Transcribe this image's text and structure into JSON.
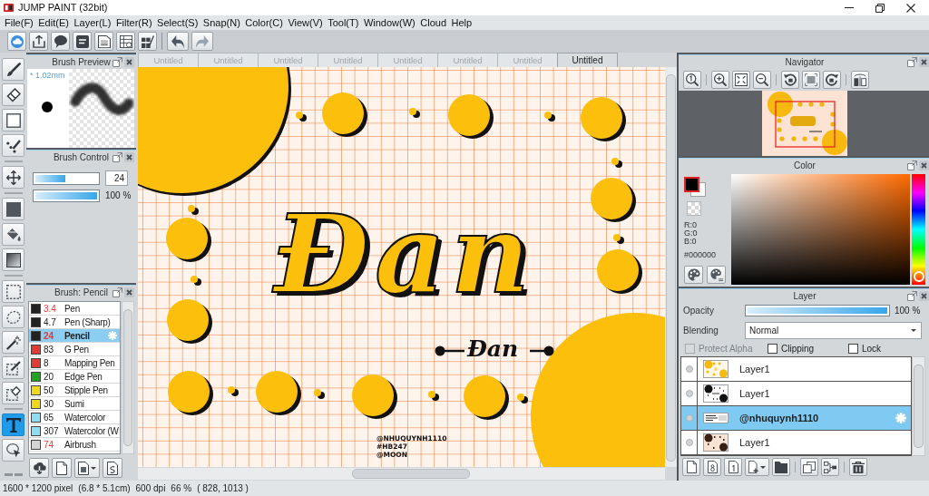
{
  "window": {
    "title": "JUMP PAINT (32bit)"
  },
  "menu": [
    "File(F)",
    "Edit(E)",
    "Layer(L)",
    "Filter(R)",
    "Select(S)",
    "Snap(N)",
    "Color(C)",
    "View(V)",
    "Tool(T)",
    "Window(W)",
    "Cloud",
    "Help"
  ],
  "tool_groups": [
    [
      {
        "kind": "brush",
        "selected": false
      },
      {
        "kind": "eraser",
        "selected": false
      },
      {
        "kind": "shape",
        "selected": false
      },
      {
        "kind": "dot",
        "selected": false
      }
    ],
    [
      {
        "kind": "move",
        "selected": false
      }
    ],
    [
      {
        "kind": "fill",
        "selected": false
      },
      {
        "kind": "bucket",
        "selected": false
      },
      {
        "kind": "gradient",
        "selected": false
      }
    ],
    [
      {
        "kind": "select",
        "selected": false
      },
      {
        "kind": "lasso",
        "selected": false
      },
      {
        "kind": "wand",
        "selected": false
      },
      {
        "kind": "select-pen",
        "selected": false
      },
      {
        "kind": "select-eraser",
        "selected": false
      }
    ],
    [
      {
        "kind": "text",
        "selected": true
      },
      {
        "kind": "object",
        "selected": false
      }
    ]
  ],
  "brush_preview": {
    "title": "Brush Preview",
    "size": "* 1.02mm"
  },
  "brush_control": {
    "title": "Brush Control",
    "sliders": [
      {
        "kind": "box",
        "level": 0.49,
        "value": "24"
      },
      {
        "kind": "reading",
        "level": 1,
        "reading": "100 %"
      }
    ]
  },
  "brush_list": {
    "title": "Brush: Pencil",
    "brushes": [
      {
        "color": "#222222",
        "size": "3.4",
        "size_highlighted": true,
        "name": "Pen",
        "selected": false
      },
      {
        "color": "#222222",
        "size": "4.7",
        "size_highlighted": false,
        "name": "Pen (Sharp)",
        "selected": false
      },
      {
        "color": "#222222",
        "size": "24",
        "size_highlighted": true,
        "name": "Pencil",
        "selected": true
      },
      {
        "color": "#e53935",
        "size": "83",
        "size_highlighted": false,
        "name": "G Pen",
        "selected": false
      },
      {
        "color": "#e53935",
        "size": "8",
        "size_highlighted": false,
        "name": "Mapping Pen",
        "selected": false
      },
      {
        "color": "#1fa51f",
        "size": "20",
        "size_highlighted": false,
        "name": "Edge Pen",
        "selected": false
      },
      {
        "color": "#efd81c",
        "size": "50",
        "size_highlighted": false,
        "name": "Stipple Pen",
        "selected": false
      },
      {
        "color": "#efd81c",
        "size": "30",
        "size_highlighted": false,
        "name": "Sumi",
        "selected": false
      },
      {
        "color": "#8fdcf5",
        "size": "65",
        "size_highlighted": false,
        "name": "Watercolor",
        "selected": false
      },
      {
        "color": "#8fdcf5",
        "size": "307",
        "size_highlighted": false,
        "name": "Watercolor (W",
        "selected": false
      },
      {
        "color": "#d4d4d4",
        "size": "74",
        "size_highlighted": true,
        "name": "Airbrush",
        "selected": false
      }
    ]
  },
  "tabs": [
    {
      "label": "Untitled",
      "selected": false
    },
    {
      "label": "Untitled",
      "selected": false
    },
    {
      "label": "Untitled",
      "selected": false
    },
    {
      "label": "Untitled",
      "selected": false
    },
    {
      "label": "Untitled",
      "selected": false
    },
    {
      "label": "Untitled",
      "selected": false
    },
    {
      "label": "Untitled",
      "selected": false
    },
    {
      "label": "Untitled",
      "selected": true
    }
  ],
  "canvas": {
    "heading": "Đan",
    "caption": "Đan",
    "signature": [
      "@NHUQUYNH1110",
      "#HB247",
      "@MOON"
    ]
  },
  "navigator": {
    "title": "Navigator"
  },
  "color": {
    "title": "Color",
    "channels": [
      "R:0",
      "G:0",
      "B:0"
    ],
    "hex": "#000000"
  },
  "layer": {
    "title": "Layer",
    "opacity": {
      "label": "Opacity",
      "level": 1,
      "reading": "100 %"
    },
    "blending": {
      "label": "Blending",
      "value": "Normal"
    },
    "options": [
      {
        "label": "Protect Alpha",
        "checked": false,
        "disabled": true
      },
      {
        "label": "Clipping",
        "checked": false,
        "disabled": false
      },
      {
        "label": "Lock",
        "checked": false,
        "disabled": false
      }
    ],
    "layers": [
      {
        "name": "Layer1",
        "kind": "circles",
        "selected": false
      },
      {
        "name": "Layer1",
        "kind": "dots",
        "selected": false
      },
      {
        "name": "@nhuquynh1110",
        "kind": "text",
        "selected": true
      },
      {
        "name": "Layer1",
        "kind": "dark",
        "selected": false
      }
    ]
  },
  "status_bar": [
    "1600 * 1200 pixel",
    "(6.8 * 5.1cm)",
    "600 dpi",
    "66 %",
    "( 828, 1013 )"
  ]
}
